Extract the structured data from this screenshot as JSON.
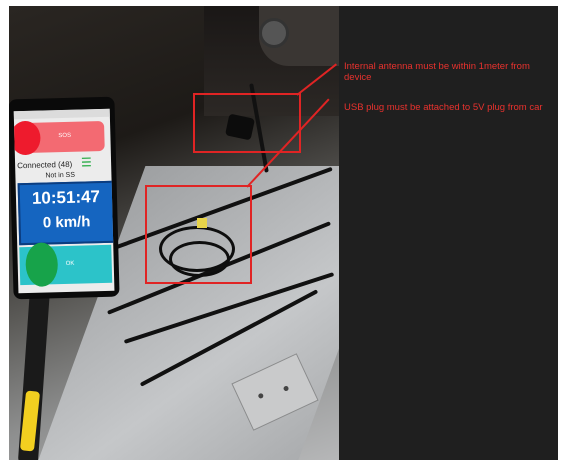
{
  "annotations": {
    "antenna_note": "Internal antenna must be within 1meter from device",
    "usb_note": "USB plug must be attached to 5V plug from car"
  },
  "phone_app": {
    "sos_label": "SOS",
    "connection_status": "Connected (48)",
    "ss_status": "Not in SS",
    "time": "10:51:47",
    "speed": "0 km/h",
    "ok_label": "OK"
  },
  "colors": {
    "annotation": "#e02424",
    "time_box": "#1565c0",
    "sos_button": "#ee1b2d",
    "ok_button": "#2cc3c9"
  }
}
